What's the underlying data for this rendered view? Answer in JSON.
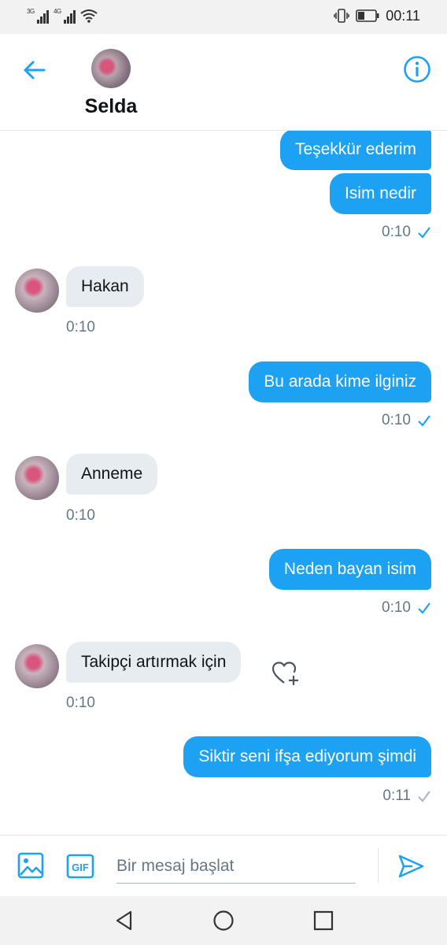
{
  "status_bar": {
    "sim1_label": "3G",
    "sim2_label": "4G",
    "time": "00:11",
    "icons": [
      "signal-icon",
      "wifi-icon",
      "vibrate-icon",
      "battery-icon"
    ]
  },
  "header": {
    "contact_name": "Selda",
    "icons": [
      "back-arrow-icon",
      "avatar",
      "info-icon"
    ]
  },
  "messages": [
    {
      "direction": "out",
      "text": "Teşekkür ederim"
    },
    {
      "direction": "out",
      "text": "Isim nedir",
      "time": "0:10",
      "status": "read"
    },
    {
      "direction": "in",
      "text": "Hakan",
      "time": "0:10"
    },
    {
      "direction": "out",
      "text": "Bu arada kime ilginiz",
      "time": "0:10",
      "status": "read"
    },
    {
      "direction": "in",
      "text": "Anneme",
      "time": "0:10"
    },
    {
      "direction": "out",
      "text": "Neden bayan isim",
      "time": "0:10",
      "status": "read"
    },
    {
      "direction": "in",
      "text": "Takipçi artırmak için",
      "time": "0:10"
    },
    {
      "direction": "out",
      "text": "Siktir seni ifşa ediyorum şimdi",
      "time": "0:11",
      "status": "sent"
    }
  ],
  "composer": {
    "placeholder": "Bir mesaj başlat",
    "gif_label": "GIF"
  },
  "colors": {
    "accent": "#1da1f2",
    "incoming_bubble": "#e6ecf0",
    "timestamp": "#657786",
    "sent_check": "#aab8c2"
  }
}
